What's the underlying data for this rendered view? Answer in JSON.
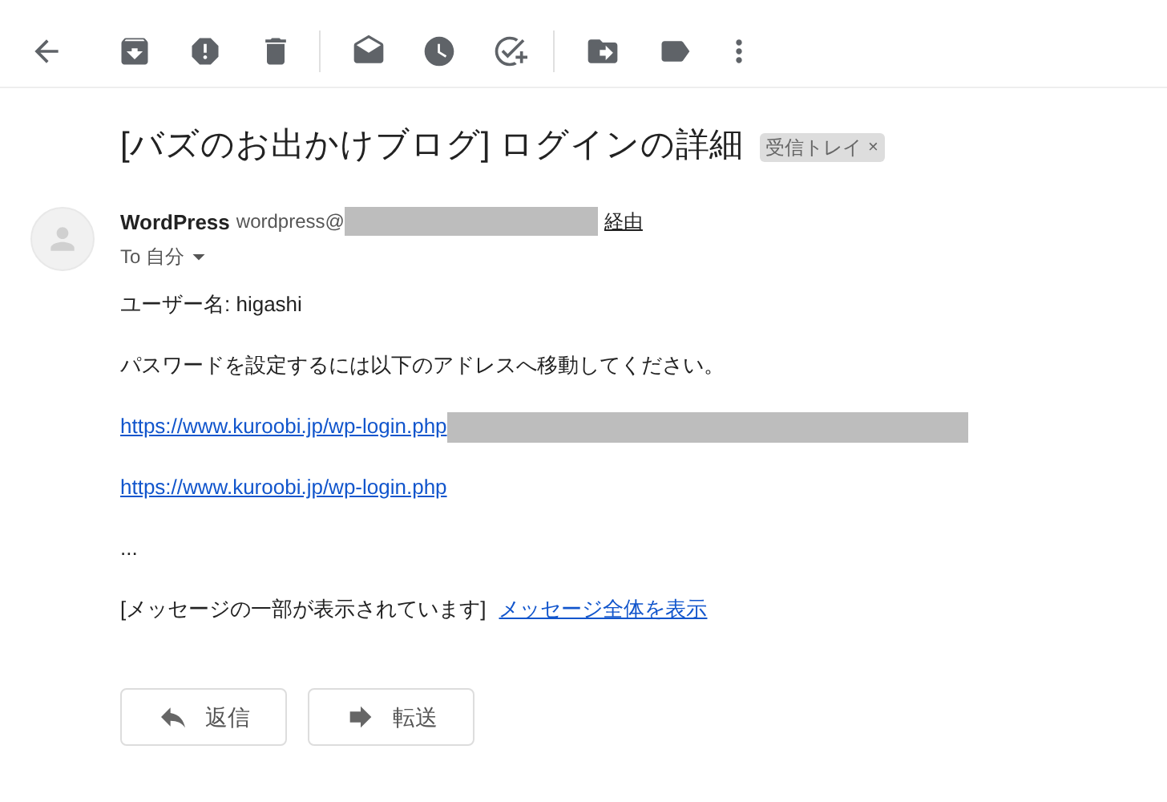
{
  "subject": {
    "title": "[バズのお出かけブログ] ログインの詳細",
    "label": "受信トレイ",
    "label_close": "×"
  },
  "sender": {
    "name": "WordPress",
    "address": "wordpress@",
    "via": "経由",
    "recipient": "To 自分"
  },
  "body": [
    {
      "kind": "text",
      "text": "ユーザー名: higashi"
    },
    {
      "kind": "text",
      "text": "パスワードを設定するには以下のアドレスへ移動してください。"
    },
    {
      "kind": "link",
      "text": "https://www.kuroobi.jp/wp-login.php",
      "redacted": true
    },
    {
      "kind": "link",
      "text": "https://www.kuroobi.jp/wp-login.php",
      "redacted": false
    },
    {
      "kind": "text",
      "text": "..."
    },
    {
      "kind": "clipped",
      "text": "[メッセージの一部が表示されています]",
      "link": "メッセージ全体を表示"
    }
  ],
  "actions": [
    {
      "kind": "reply",
      "label": "返信"
    },
    {
      "kind": "forward",
      "label": "転送"
    }
  ]
}
